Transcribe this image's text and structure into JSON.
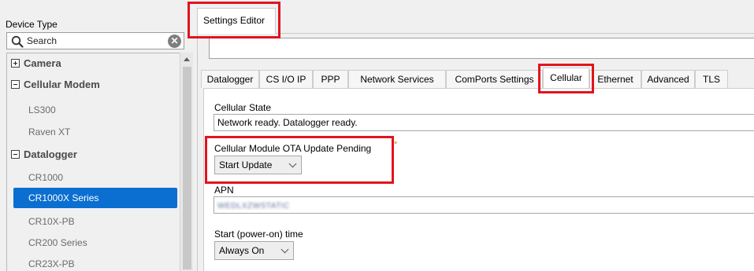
{
  "left_panel": {
    "title": "Device Type",
    "search": {
      "placeholder": "Search",
      "clear_symbol": "✕"
    },
    "tree": [
      {
        "label": "Camera",
        "kind": "group",
        "expanded": false
      },
      {
        "label": "Cellular Modem",
        "kind": "group",
        "expanded": true
      },
      {
        "label": "LS300",
        "kind": "leaf"
      },
      {
        "label": "Raven XT",
        "kind": "leaf"
      },
      {
        "label": "Datalogger",
        "kind": "group",
        "expanded": true
      },
      {
        "label": "CR1000",
        "kind": "leaf"
      },
      {
        "label": "CR1000X Series",
        "kind": "leaf",
        "selected": true
      },
      {
        "label": "CR10X-PB",
        "kind": "leaf"
      },
      {
        "label": "CR200 Series",
        "kind": "leaf"
      },
      {
        "label": "CR23X-PB",
        "kind": "leaf"
      }
    ]
  },
  "editor": {
    "tab_label": "Settings Editor",
    "tabs": [
      "Datalogger",
      "CS I/O IP",
      "PPP",
      "Network Services",
      "ComPorts Settings",
      "Cellular",
      "Ethernet",
      "Advanced",
      "TLS"
    ],
    "active_tab": "Cellular",
    "fields": {
      "cellular_state": {
        "label": "Cellular State",
        "value": "Network ready. Datalogger ready."
      },
      "ota_update": {
        "label": "Cellular Module OTA Update Pending",
        "value": "Start Update",
        "modified_marker": "*"
      },
      "apn": {
        "label": "APN",
        "value": "WEDLXZWSTATIC"
      },
      "start_time": {
        "label": "Start (power-on) time",
        "value": "Always On"
      }
    }
  },
  "colors": {
    "selection": "#0a6fd0",
    "highlight": "#e1141e",
    "panel_bg": "#f0f0f0"
  }
}
